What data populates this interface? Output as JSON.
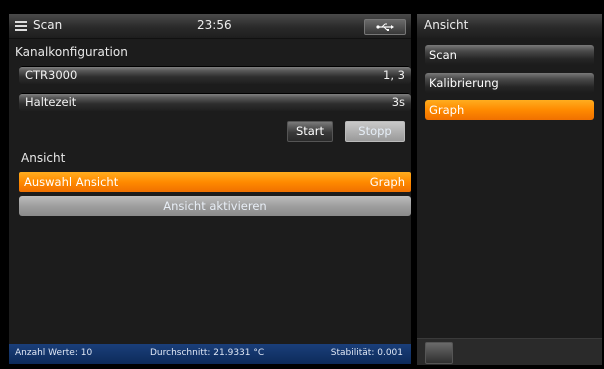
{
  "header": {
    "title": "Scan",
    "time": "23:56",
    "menu_icon": "hamburger-menu-icon",
    "usb_icon": "usb-icon"
  },
  "channel_config": {
    "label": "Kanalkonfiguration",
    "device": "CTR3000",
    "channels": "1, 3",
    "hold_label": "Haltezeit",
    "hold_value": "3s"
  },
  "buttons": {
    "start": "Start",
    "stopp": "Stopp"
  },
  "view": {
    "label": "Ansicht",
    "select_label": "Auswahl Ansicht",
    "select_value": "Graph",
    "activate": "Ansicht aktivieren"
  },
  "status": {
    "count": "Anzahl Werte: 10",
    "average": "Durchschnitt: 21.9331 °C",
    "stability": "Stabilität: 0.001"
  },
  "sidebar": {
    "title": "Ansicht",
    "items": [
      {
        "label": "Scan",
        "active": false
      },
      {
        "label": "Kalibrierung",
        "active": false
      },
      {
        "label": "Graph",
        "active": true
      }
    ]
  },
  "colors": {
    "accent": "#ff8c00",
    "status_bar": "#123570",
    "panel_bg": "#1c1c1c"
  }
}
